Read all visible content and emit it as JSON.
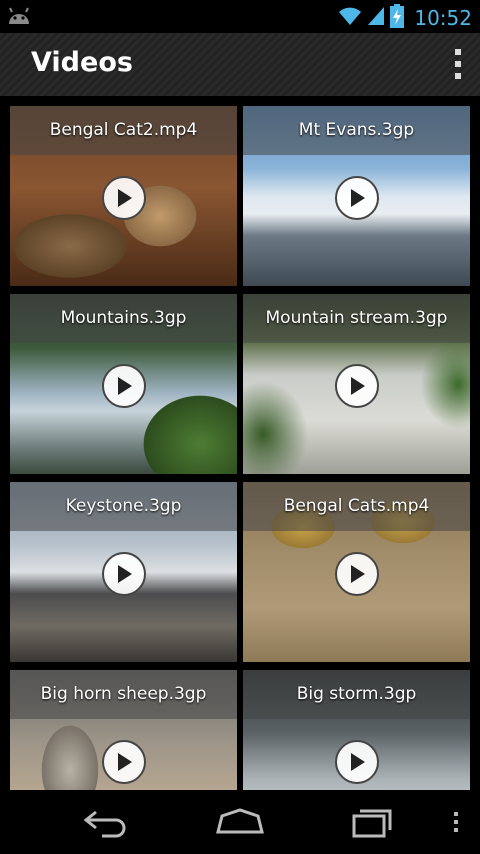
{
  "status_bar": {
    "time": "10:52",
    "icons": [
      "android-icon",
      "wifi-icon",
      "signal-icon",
      "battery-charging-icon"
    ],
    "time_color": "#4db8e8"
  },
  "action_bar": {
    "title": "Videos",
    "overflow_icon": "overflow-menu-icon"
  },
  "videos": [
    {
      "name": "Bengal Cat2.mp4"
    },
    {
      "name": "Mt Evans.3gp"
    },
    {
      "name": "Mountains.3gp"
    },
    {
      "name": "Mountain stream.3gp"
    },
    {
      "name": "Keystone.3gp"
    },
    {
      "name": "Bengal Cats.mp4"
    },
    {
      "name": "Big horn sheep.3gp"
    },
    {
      "name": "Big storm.3gp"
    }
  ],
  "nav_bar": {
    "icons": [
      "back-icon",
      "home-icon",
      "recent-apps-icon",
      "menu-icon"
    ]
  }
}
